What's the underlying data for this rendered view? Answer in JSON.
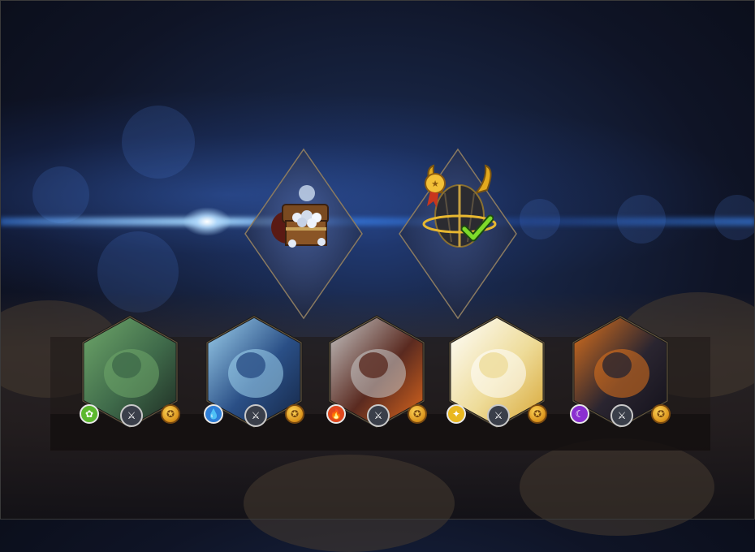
{
  "scene": {
    "accent_blue": "#5aa0ff",
    "glow_white": "#e6f2ff"
  },
  "rewards": [
    {
      "name": "treasure-chest",
      "icon": "diamond-chest-icon",
      "claimed": false
    },
    {
      "name": "horned-helmet",
      "icon": "horned-helmet-icon",
      "claimed": true,
      "status_icon": "checkmark-icon"
    }
  ],
  "heroes": [
    {
      "id": "hero-1",
      "element": "nature",
      "element_color": "#5cb82e",
      "element_glyph": "✿",
      "art_palette": [
        "#3f6a4a",
        "#6fa86a",
        "#1d2a22"
      ],
      "class_icon": "sword-icon",
      "tier_icon": "gold-medal-icon"
    },
    {
      "id": "hero-2",
      "element": "water",
      "element_color": "#2f7fd8",
      "element_glyph": "💧",
      "art_palette": [
        "#2a4f86",
        "#9fd3ef",
        "#152645"
      ],
      "class_icon": "sword-icon",
      "tier_icon": "gold-medal-icon"
    },
    {
      "id": "hero-3",
      "element": "fire",
      "element_color": "#e0481e",
      "element_glyph": "🔥",
      "art_palette": [
        "#5a2a20",
        "#c9caca",
        "#e36a1c"
      ],
      "class_icon": "sword-icon",
      "tier_icon": "gold-medal-icon"
    },
    {
      "id": "hero-4",
      "element": "light",
      "element_color": "#e9b820",
      "element_glyph": "✦",
      "art_palette": [
        "#eedc9a",
        "#ffffff",
        "#d7a533"
      ],
      "class_icon": "sword-icon",
      "tier_icon": "gold-medal-icon"
    },
    {
      "id": "hero-5",
      "element": "dark",
      "element_color": "#8a2fd0",
      "element_glyph": "☾",
      "art_palette": [
        "#2a2530",
        "#e0731c",
        "#12101a"
      ],
      "class_icon": "sword-icon",
      "tier_icon": "gold-medal-icon"
    }
  ]
}
